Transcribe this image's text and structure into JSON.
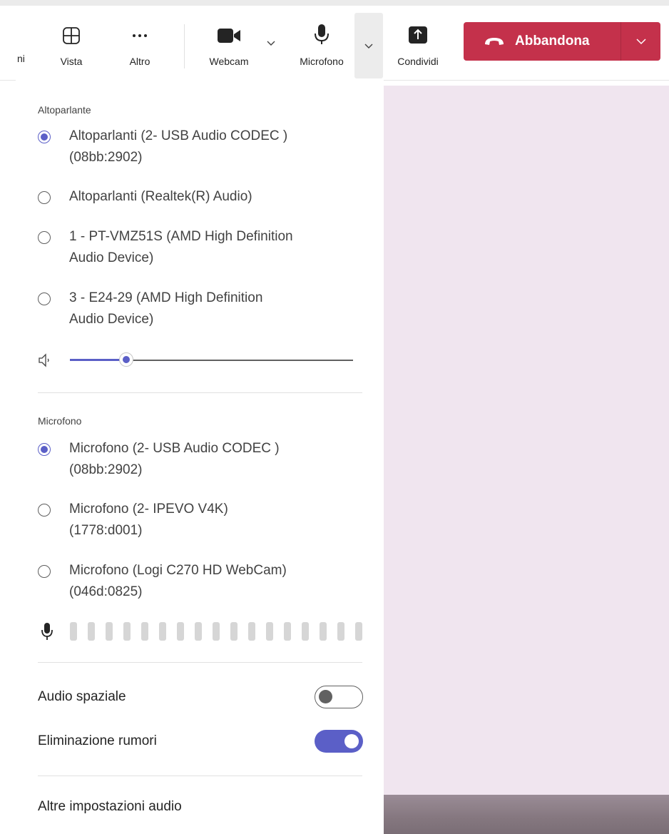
{
  "toolbar": {
    "partial_label": "ni",
    "view_label": "Vista",
    "more_label": "Altro",
    "webcam_label": "Webcam",
    "microphone_label": "Microfono",
    "share_label": "Condividi",
    "leave_label": "Abbandona",
    "leave_color": "#c4314b"
  },
  "speaker": {
    "title": "Altoparlante",
    "options": [
      {
        "label": "Altoparlanti (2- USB Audio CODEC )",
        "label2": "(08bb:2902)",
        "selected": true
      },
      {
        "label": "Altoparlanti (Realtek(R) Audio)",
        "label2": "",
        "selected": false
      },
      {
        "label": "1 - PT-VMZ51S (AMD High Definition",
        "label2": "Audio Device)",
        "selected": false
      },
      {
        "label": "3 - E24-29 (AMD High Definition",
        "label2": "Audio Device)",
        "selected": false
      }
    ],
    "volume_fraction": 0.2
  },
  "microphone": {
    "title": "Microfono",
    "options": [
      {
        "label": "Microfono (2- USB Audio CODEC )",
        "label2": "(08bb:2902)",
        "selected": true
      },
      {
        "label": "Microfono (2- IPEVO V4K)",
        "label2": "(1778:d001)",
        "selected": false
      },
      {
        "label": "Microfono (Logi C270 HD WebCam)",
        "label2": "(046d:0825)",
        "selected": false
      }
    ],
    "level_bars_lit": 0
  },
  "settings": {
    "spatial_audio_label": "Audio spaziale",
    "spatial_audio_on": false,
    "noise_suppression_label": "Eliminazione rumori",
    "noise_suppression_on": true,
    "more_settings_label": "Altre impostazioni audio"
  },
  "colors": {
    "accent": "#5b5fc7",
    "video_background": "#f0e5ef"
  }
}
